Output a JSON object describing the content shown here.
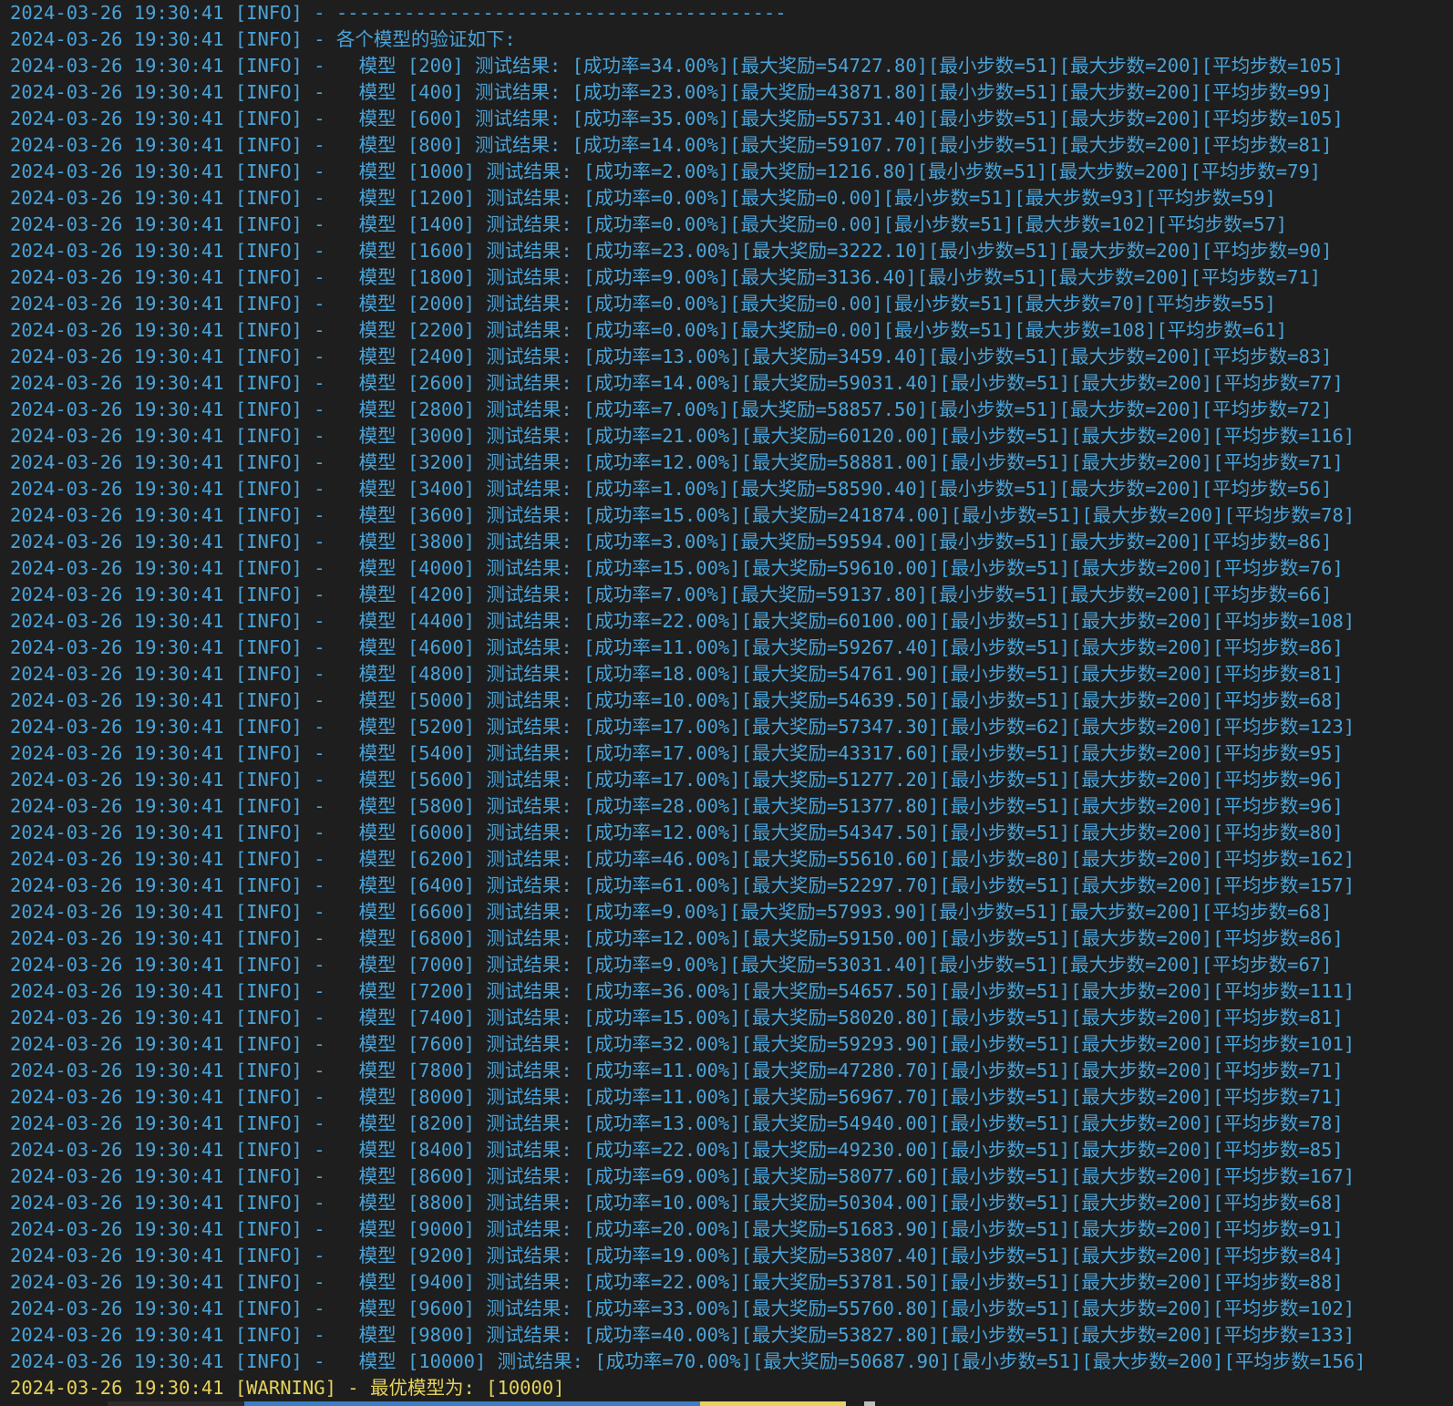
{
  "log": {
    "lines": [
      {
        "text": "2024-03-26 19:30:41 [INFO] - ----------------------------------------",
        "level": "info"
      },
      {
        "text": "2024-03-26 19:30:41 [INFO] - 各个模型的验证如下:",
        "level": "info"
      },
      {
        "text": "2024-03-26 19:30:41 [INFO] -   模型 [200] 测试结果: [成功率=34.00%][最大奖励=54727.80][最小步数=51][最大步数=200][平均步数=105]",
        "level": "info"
      },
      {
        "text": "2024-03-26 19:30:41 [INFO] -   模型 [400] 测试结果: [成功率=23.00%][最大奖励=43871.80][最小步数=51][最大步数=200][平均步数=99]",
        "level": "info"
      },
      {
        "text": "2024-03-26 19:30:41 [INFO] -   模型 [600] 测试结果: [成功率=35.00%][最大奖励=55731.40][最小步数=51][最大步数=200][平均步数=105]",
        "level": "info"
      },
      {
        "text": "2024-03-26 19:30:41 [INFO] -   模型 [800] 测试结果: [成功率=14.00%][最大奖励=59107.70][最小步数=51][最大步数=200][平均步数=81]",
        "level": "info"
      },
      {
        "text": "2024-03-26 19:30:41 [INFO] -   模型 [1000] 测试结果: [成功率=2.00%][最大奖励=1216.80][最小步数=51][最大步数=200][平均步数=79]",
        "level": "info"
      },
      {
        "text": "2024-03-26 19:30:41 [INFO] -   模型 [1200] 测试结果: [成功率=0.00%][最大奖励=0.00][最小步数=51][最大步数=93][平均步数=59]",
        "level": "info"
      },
      {
        "text": "2024-03-26 19:30:41 [INFO] -   模型 [1400] 测试结果: [成功率=0.00%][最大奖励=0.00][最小步数=51][最大步数=102][平均步数=57]",
        "level": "info"
      },
      {
        "text": "2024-03-26 19:30:41 [INFO] -   模型 [1600] 测试结果: [成功率=23.00%][最大奖励=3222.10][最小步数=51][最大步数=200][平均步数=90]",
        "level": "info"
      },
      {
        "text": "2024-03-26 19:30:41 [INFO] -   模型 [1800] 测试结果: [成功率=9.00%][最大奖励=3136.40][最小步数=51][最大步数=200][平均步数=71]",
        "level": "info"
      },
      {
        "text": "2024-03-26 19:30:41 [INFO] -   模型 [2000] 测试结果: [成功率=0.00%][最大奖励=0.00][最小步数=51][最大步数=70][平均步数=55]",
        "level": "info"
      },
      {
        "text": "2024-03-26 19:30:41 [INFO] -   模型 [2200] 测试结果: [成功率=0.00%][最大奖励=0.00][最小步数=51][最大步数=108][平均步数=61]",
        "level": "info"
      },
      {
        "text": "2024-03-26 19:30:41 [INFO] -   模型 [2400] 测试结果: [成功率=13.00%][最大奖励=3459.40][最小步数=51][最大步数=200][平均步数=83]",
        "level": "info"
      },
      {
        "text": "2024-03-26 19:30:41 [INFO] -   模型 [2600] 测试结果: [成功率=14.00%][最大奖励=59031.40][最小步数=51][最大步数=200][平均步数=77]",
        "level": "info"
      },
      {
        "text": "2024-03-26 19:30:41 [INFO] -   模型 [2800] 测试结果: [成功率=7.00%][最大奖励=58857.50][最小步数=51][最大步数=200][平均步数=72]",
        "level": "info"
      },
      {
        "text": "2024-03-26 19:30:41 [INFO] -   模型 [3000] 测试结果: [成功率=21.00%][最大奖励=60120.00][最小步数=51][最大步数=200][平均步数=116]",
        "level": "info"
      },
      {
        "text": "2024-03-26 19:30:41 [INFO] -   模型 [3200] 测试结果: [成功率=12.00%][最大奖励=58881.00][最小步数=51][最大步数=200][平均步数=71]",
        "level": "info"
      },
      {
        "text": "2024-03-26 19:30:41 [INFO] -   模型 [3400] 测试结果: [成功率=1.00%][最大奖励=58590.40][最小步数=51][最大步数=200][平均步数=56]",
        "level": "info"
      },
      {
        "text": "2024-03-26 19:30:41 [INFO] -   模型 [3600] 测试结果: [成功率=15.00%][最大奖励=241874.00][最小步数=51][最大步数=200][平均步数=78]",
        "level": "info"
      },
      {
        "text": "2024-03-26 19:30:41 [INFO] -   模型 [3800] 测试结果: [成功率=3.00%][最大奖励=59594.00][最小步数=51][最大步数=200][平均步数=86]",
        "level": "info"
      },
      {
        "text": "2024-03-26 19:30:41 [INFO] -   模型 [4000] 测试结果: [成功率=15.00%][最大奖励=59610.00][最小步数=51][最大步数=200][平均步数=76]",
        "level": "info"
      },
      {
        "text": "2024-03-26 19:30:41 [INFO] -   模型 [4200] 测试结果: [成功率=7.00%][最大奖励=59137.80][最小步数=51][最大步数=200][平均步数=66]",
        "level": "info"
      },
      {
        "text": "2024-03-26 19:30:41 [INFO] -   模型 [4400] 测试结果: [成功率=22.00%][最大奖励=60100.00][最小步数=51][最大步数=200][平均步数=108]",
        "level": "info"
      },
      {
        "text": "2024-03-26 19:30:41 [INFO] -   模型 [4600] 测试结果: [成功率=11.00%][最大奖励=59267.40][最小步数=51][最大步数=200][平均步数=86]",
        "level": "info"
      },
      {
        "text": "2024-03-26 19:30:41 [INFO] -   模型 [4800] 测试结果: [成功率=18.00%][最大奖励=54761.90][最小步数=51][最大步数=200][平均步数=81]",
        "level": "info"
      },
      {
        "text": "2024-03-26 19:30:41 [INFO] -   模型 [5000] 测试结果: [成功率=10.00%][最大奖励=54639.50][最小步数=51][最大步数=200][平均步数=68]",
        "level": "info"
      },
      {
        "text": "2024-03-26 19:30:41 [INFO] -   模型 [5200] 测试结果: [成功率=17.00%][最大奖励=57347.30][最小步数=62][最大步数=200][平均步数=123]",
        "level": "info"
      },
      {
        "text": "2024-03-26 19:30:41 [INFO] -   模型 [5400] 测试结果: [成功率=17.00%][最大奖励=43317.60][最小步数=51][最大步数=200][平均步数=95]",
        "level": "info"
      },
      {
        "text": "2024-03-26 19:30:41 [INFO] -   模型 [5600] 测试结果: [成功率=17.00%][最大奖励=51277.20][最小步数=51][最大步数=200][平均步数=96]",
        "level": "info"
      },
      {
        "text": "2024-03-26 19:30:41 [INFO] -   模型 [5800] 测试结果: [成功率=28.00%][最大奖励=51377.80][最小步数=51][最大步数=200][平均步数=96]",
        "level": "info"
      },
      {
        "text": "2024-03-26 19:30:41 [INFO] -   模型 [6000] 测试结果: [成功率=12.00%][最大奖励=54347.50][最小步数=51][最大步数=200][平均步数=80]",
        "level": "info"
      },
      {
        "text": "2024-03-26 19:30:41 [INFO] -   模型 [6200] 测试结果: [成功率=46.00%][最大奖励=55610.60][最小步数=80][最大步数=200][平均步数=162]",
        "level": "info"
      },
      {
        "text": "2024-03-26 19:30:41 [INFO] -   模型 [6400] 测试结果: [成功率=61.00%][最大奖励=52297.70][最小步数=51][最大步数=200][平均步数=157]",
        "level": "info"
      },
      {
        "text": "2024-03-26 19:30:41 [INFO] -   模型 [6600] 测试结果: [成功率=9.00%][最大奖励=57993.90][最小步数=51][最大步数=200][平均步数=68]",
        "level": "info"
      },
      {
        "text": "2024-03-26 19:30:41 [INFO] -   模型 [6800] 测试结果: [成功率=12.00%][最大奖励=59150.00][最小步数=51][最大步数=200][平均步数=86]",
        "level": "info"
      },
      {
        "text": "2024-03-26 19:30:41 [INFO] -   模型 [7000] 测试结果: [成功率=9.00%][最大奖励=53031.40][最小步数=51][最大步数=200][平均步数=67]",
        "level": "info"
      },
      {
        "text": "2024-03-26 19:30:41 [INFO] -   模型 [7200] 测试结果: [成功率=36.00%][最大奖励=54657.50][最小步数=51][最大步数=200][平均步数=111]",
        "level": "info"
      },
      {
        "text": "2024-03-26 19:30:41 [INFO] -   模型 [7400] 测试结果: [成功率=15.00%][最大奖励=58020.80][最小步数=51][最大步数=200][平均步数=81]",
        "level": "info"
      },
      {
        "text": "2024-03-26 19:30:41 [INFO] -   模型 [7600] 测试结果: [成功率=32.00%][最大奖励=59293.90][最小步数=51][最大步数=200][平均步数=101]",
        "level": "info"
      },
      {
        "text": "2024-03-26 19:30:41 [INFO] -   模型 [7800] 测试结果: [成功率=11.00%][最大奖励=47280.70][最小步数=51][最大步数=200][平均步数=71]",
        "level": "info"
      },
      {
        "text": "2024-03-26 19:30:41 [INFO] -   模型 [8000] 测试结果: [成功率=11.00%][最大奖励=56967.70][最小步数=51][最大步数=200][平均步数=71]",
        "level": "info"
      },
      {
        "text": "2024-03-26 19:30:41 [INFO] -   模型 [8200] 测试结果: [成功率=13.00%][最大奖励=54940.00][最小步数=51][最大步数=200][平均步数=78]",
        "level": "info"
      },
      {
        "text": "2024-03-26 19:30:41 [INFO] -   模型 [8400] 测试结果: [成功率=22.00%][最大奖励=49230.00][最小步数=51][最大步数=200][平均步数=85]",
        "level": "info"
      },
      {
        "text": "2024-03-26 19:30:41 [INFO] -   模型 [8600] 测试结果: [成功率=69.00%][最大奖励=58077.60][最小步数=51][最大步数=200][平均步数=167]",
        "level": "info"
      },
      {
        "text": "2024-03-26 19:30:41 [INFO] -   模型 [8800] 测试结果: [成功率=10.00%][最大奖励=50304.00][最小步数=51][最大步数=200][平均步数=68]",
        "level": "info"
      },
      {
        "text": "2024-03-26 19:30:41 [INFO] -   模型 [9000] 测试结果: [成功率=20.00%][最大奖励=51683.90][最小步数=51][最大步数=200][平均步数=91]",
        "level": "info"
      },
      {
        "text": "2024-03-26 19:30:41 [INFO] -   模型 [9200] 测试结果: [成功率=19.00%][最大奖励=53807.40][最小步数=51][最大步数=200][平均步数=84]",
        "level": "info"
      },
      {
        "text": "2024-03-26 19:30:41 [INFO] -   模型 [9400] 测试结果: [成功率=22.00%][最大奖励=53781.50][最小步数=51][最大步数=200][平均步数=88]",
        "level": "info"
      },
      {
        "text": "2024-03-26 19:30:41 [INFO] -   模型 [9600] 测试结果: [成功率=33.00%][最大奖励=55760.80][最小步数=51][最大步数=200][平均步数=102]",
        "level": "info"
      },
      {
        "text": "2024-03-26 19:30:41 [INFO] -   模型 [9800] 测试结果: [成功率=40.00%][最大奖励=53827.80][最小步数=51][最大步数=200][平均步数=133]",
        "level": "info"
      },
      {
        "text": "2024-03-26 19:30:41 [INFO] -   模型 [10000] 测试结果: [成功率=70.00%][最大奖励=50687.90][最小步数=51][最大步数=200][平均步数=156]",
        "level": "info"
      },
      {
        "text": "2024-03-26 19:30:41 [WARNING] - 最优模型为: [10000]",
        "level": "warning"
      }
    ]
  },
  "colors": {
    "background": "#1e1e1e",
    "info_text": "#4aa3d9",
    "warning_text": "#e6d35a",
    "statusbar_blue": "#3b7fc4",
    "statusbar_yellow": "#e6d35a"
  }
}
